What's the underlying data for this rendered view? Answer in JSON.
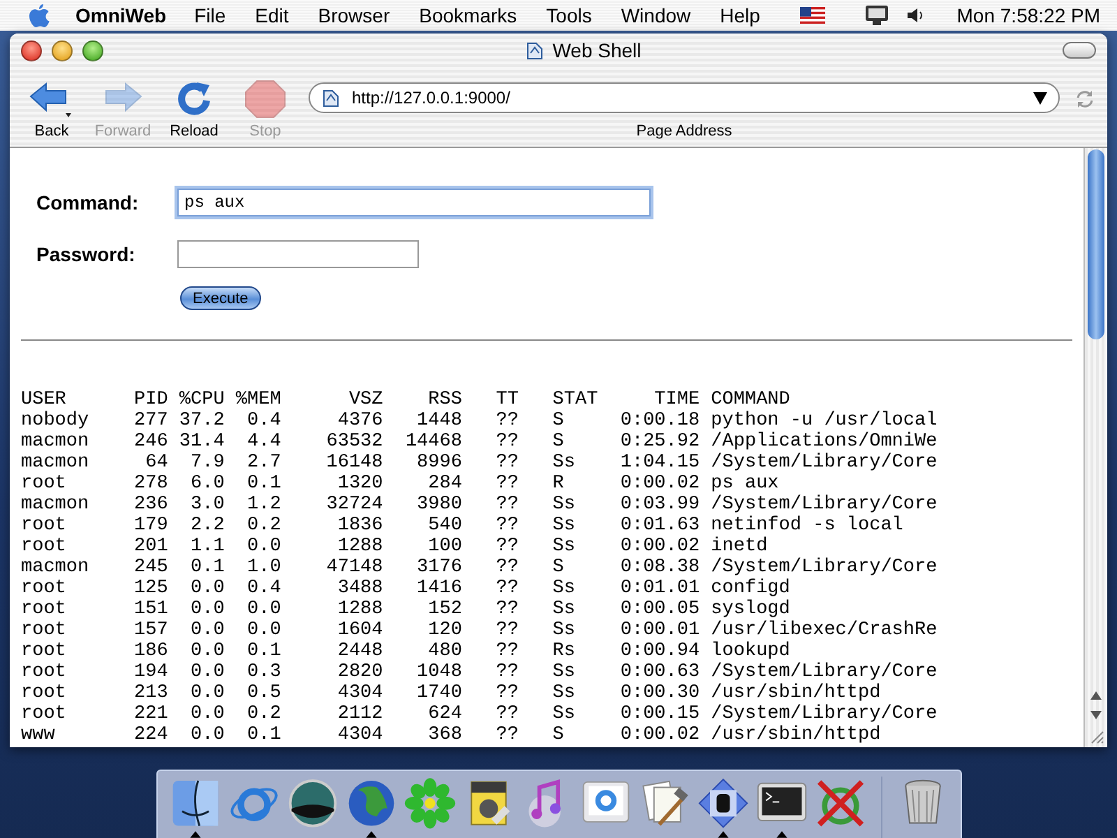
{
  "menu_bar": {
    "app": "OmniWeb",
    "items": [
      "File",
      "Edit",
      "Browser",
      "Bookmarks",
      "Tools",
      "Window",
      "Help"
    ],
    "clock": "Mon 7:58:22 PM"
  },
  "window": {
    "title": "Web Shell"
  },
  "toolbar": {
    "buttons": [
      {
        "label": "Back",
        "disabled": false
      },
      {
        "label": "Forward",
        "disabled": true
      },
      {
        "label": "Reload",
        "disabled": false
      },
      {
        "label": "Stop",
        "disabled": true
      }
    ],
    "address": "http://127.0.0.1:9000/",
    "address_label": "Page Address"
  },
  "form": {
    "command_label": "Command:",
    "command_value": "ps aux",
    "command_focused": true,
    "password_label": "Password:",
    "button": "Execute"
  },
  "output": [
    "USER      PID %CPU %MEM      VSZ    RSS   TT   STAT     TIME COMMAND",
    "nobody    277 37.2  0.4     4376   1448   ??   S     0:00.18 python -u /usr/local",
    "macmon    246 31.4  4.4    63532  14468   ??   S     0:25.92 /Applications/OmniWe",
    "macmon     64  7.9  2.7    16148   8996   ??   Ss    1:04.15 /System/Library/Core",
    "root      278  6.0  0.1     1320    284   ??   R     0:00.02 ps aux",
    "macmon    236  3.0  1.2    32724   3980   ??   Ss    0:03.99 /System/Library/Core",
    "root      179  2.2  0.2     1836    540   ??   Ss    0:01.63 netinfod -s local",
    "root      201  1.1  0.0     1288    100   ??   Ss    0:00.02 inetd",
    "macmon    245  0.1  1.0    47148   3176   ??   S     0:08.38 /System/Library/Core",
    "root      125  0.0  0.4     3488   1416   ??   Ss    0:01.01 configd",
    "root      151  0.0  0.0     1288    152   ??   Ss    0:00.05 syslogd",
    "root      157  0.0  0.0     1604    120   ??   Ss    0:00.01 /usr/libexec/CrashRe",
    "root      186  0.0  0.1     2448    480   ??   Rs    0:00.94 lookupd",
    "root      194  0.0  0.3     2820   1048   ??   Ss    0:00.63 /System/Library/Core",
    "root      213  0.0  0.5     4304   1740   ??   Ss    0:00.30 /usr/sbin/httpd",
    "root      221  0.0  0.2     2112    624   ??   Ss    0:00.15 /System/Library/Core",
    "www       224  0.0  0.1     4304    368   ??   S     0:00.02 /usr/sbin/httpd"
  ],
  "dock": {
    "items": [
      {
        "running": true
      },
      {
        "running": false
      },
      {
        "running": false
      },
      {
        "running": true
      },
      {
        "running": false
      },
      {
        "running": false
      },
      {
        "running": false
      },
      {
        "running": false
      },
      {
        "running": false
      },
      {
        "running": true
      },
      {
        "running": true
      },
      {
        "running": false
      }
    ]
  }
}
